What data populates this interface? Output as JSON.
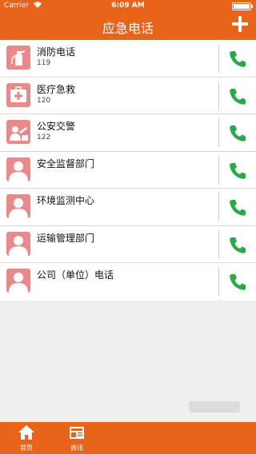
{
  "status_bar": {
    "carrier": "Carrier",
    "time": "6:09 AM"
  },
  "header": {
    "title": "应急电话"
  },
  "contacts": [
    {
      "name": "消防电话",
      "number": "119",
      "icon": "fire-extinguisher-icon"
    },
    {
      "name": "医疗急救",
      "number": "120",
      "icon": "medical-cross-icon"
    },
    {
      "name": "公安交警",
      "number": "122",
      "icon": "traffic-police-icon"
    },
    {
      "name": "安全监督部门",
      "number": "",
      "icon": "person-icon"
    },
    {
      "name": "环境监测中心",
      "number": "",
      "icon": "person-icon"
    },
    {
      "name": "运输管理部门",
      "number": "",
      "icon": "person-icon"
    },
    {
      "name": "公司（单位）电话",
      "number": "",
      "icon": "person-icon"
    }
  ],
  "tabbar": [
    {
      "label": "首页",
      "icon": "home-icon"
    },
    {
      "label": "资讯",
      "icon": "news-icon"
    }
  ],
  "colors": {
    "primary": "#e8641b",
    "call_green": "#2aa84a",
    "avatar": "#e98a8a"
  }
}
